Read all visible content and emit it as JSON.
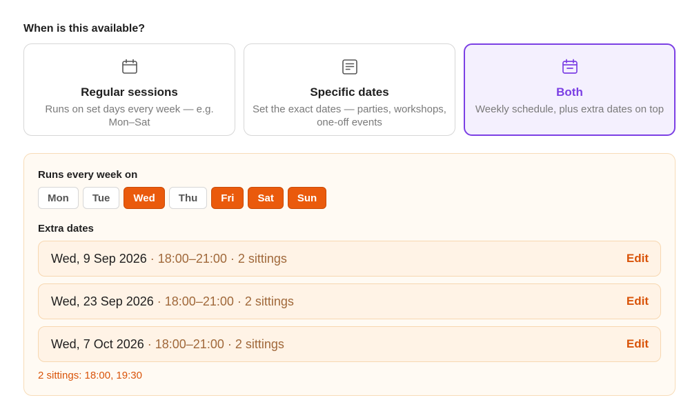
{
  "question": "When is this available?",
  "options": [
    {
      "icon": "calendar-icon",
      "title": "Regular sessions",
      "description": "Runs on set days every week — e.g. Mon–Sat",
      "selected": false
    },
    {
      "icon": "document-icon",
      "title": "Specific dates",
      "description": "Set the exact dates — parties, workshops, one-off events",
      "selected": false
    },
    {
      "icon": "calendar-icon",
      "title": "Both",
      "description": "Weekly schedule, plus extra dates on top",
      "selected": true
    }
  ],
  "weekly": {
    "label": "Runs every week on",
    "days": [
      {
        "label": "Mon",
        "active": false
      },
      {
        "label": "Tue",
        "active": false
      },
      {
        "label": "Wed",
        "active": true
      },
      {
        "label": "Thu",
        "active": false
      },
      {
        "label": "Fri",
        "active": true
      },
      {
        "label": "Sat",
        "active": true
      },
      {
        "label": "Sun",
        "active": true
      }
    ]
  },
  "extra": {
    "label": "Extra dates",
    "dates": [
      {
        "date": "Wed, 9 Sep 2026",
        "meta": " · 18:00–21:00 · 2 sittings",
        "action": "Edit"
      },
      {
        "date": "Wed, 23 Sep 2026",
        "meta": " · 18:00–21:00 · 2 sittings",
        "action": "Edit"
      },
      {
        "date": "Wed, 7 Oct 2026",
        "meta": " · 18:00–21:00 · 2 sittings",
        "action": "Edit"
      }
    ],
    "footnote": "2 sittings: 18:00, 19:30"
  },
  "colors": {
    "accent_purple": "#7b3fe4",
    "accent_orange": "#ea5a0c",
    "panel_bg": "#fffaf3"
  }
}
